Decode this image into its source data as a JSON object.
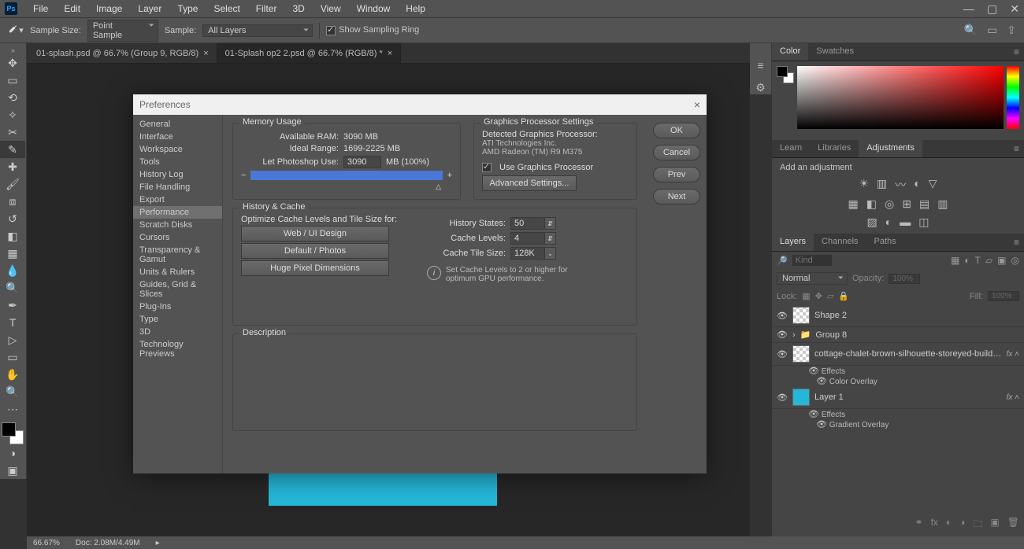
{
  "menu": {
    "items": [
      "File",
      "Edit",
      "Image",
      "Layer",
      "Type",
      "Select",
      "Filter",
      "3D",
      "View",
      "Window",
      "Help"
    ]
  },
  "options": {
    "sample_size_label": "Sample Size:",
    "sample_size_value": "Point Sample",
    "sample_label": "Sample:",
    "sample_value": "All Layers",
    "show_ring": "Show Sampling Ring"
  },
  "tabs": [
    {
      "label": "01-splash.psd @ 66.7% (Group 9, RGB/8)",
      "active": false
    },
    {
      "label": "01-Splash op2 2.psd @ 66.7% (RGB/8) *",
      "active": true
    }
  ],
  "panels": {
    "color_tabs": [
      "Color",
      "Swatches"
    ],
    "adj_tabs": [
      "Learn",
      "Libraries",
      "Adjustments"
    ],
    "adj_title": "Add an adjustment",
    "layer_tabs": [
      "Layers",
      "Channels",
      "Paths"
    ],
    "search_placeholder": "Kind",
    "blend_mode": "Normal",
    "opacity_label": "Opacity:",
    "opacity_value": "100%",
    "lock_label": "Lock:",
    "fill_label": "Fill:",
    "fill_value": "100%",
    "layers": [
      {
        "name": "Shape 2",
        "thumb": "shape"
      },
      {
        "name": "Group 8",
        "thumb": "folder",
        "expand": true
      },
      {
        "name": "cottage-chalet-brown-silhouette-storeyed-building-4964...",
        "thumb": "shape",
        "fx": true
      },
      {
        "effects_for": 2,
        "effects": [
          "Effects",
          "Color Overlay"
        ]
      },
      {
        "name": "Layer 1",
        "thumb": "cyan",
        "fx": true
      },
      {
        "effects_for": 4,
        "effects": [
          "Effects",
          "Gradient Overlay"
        ]
      }
    ]
  },
  "status": {
    "zoom": "66.67%",
    "doc": "Doc: 2.08M/4.49M"
  },
  "prefs": {
    "title": "Preferences",
    "categories": [
      "General",
      "Interface",
      "Workspace",
      "Tools",
      "History Log",
      "File Handling",
      "Export",
      "Performance",
      "Scratch Disks",
      "Cursors",
      "Transparency & Gamut",
      "Units & Rulers",
      "Guides, Grid & Slices",
      "Plug-Ins",
      "Type",
      "3D",
      "Technology Previews"
    ],
    "active_category": "Performance",
    "buttons": {
      "ok": "OK",
      "cancel": "Cancel",
      "prev": "Prev",
      "next": "Next"
    },
    "memory": {
      "title": "Memory Usage",
      "available_label": "Available RAM:",
      "available_value": "3090 MB",
      "ideal_label": "Ideal Range:",
      "ideal_value": "1699-2225 MB",
      "let_label": "Let Photoshop Use:",
      "let_value": "3090",
      "let_suffix": "MB (100%)"
    },
    "gpu": {
      "title": "Graphics Processor Settings",
      "detected_label": "Detected Graphics Processor:",
      "vendor": "ATI Technologies Inc.",
      "model": "AMD Radeon (TM) R9 M375",
      "use_label": "Use Graphics Processor",
      "advanced": "Advanced Settings..."
    },
    "history": {
      "title": "History & Cache",
      "optimize_label": "Optimize Cache Levels and Tile Size for:",
      "presets": [
        "Web / UI Design",
        "Default / Photos",
        "Huge Pixel Dimensions"
      ],
      "states_label": "History States:",
      "states_value": "50",
      "levels_label": "Cache Levels:",
      "levels_value": "4",
      "tile_label": "Cache Tile Size:",
      "tile_value": "128K",
      "hint": "Set Cache Levels to 2 or higher for optimum GPU performance."
    },
    "desc_title": "Description"
  }
}
